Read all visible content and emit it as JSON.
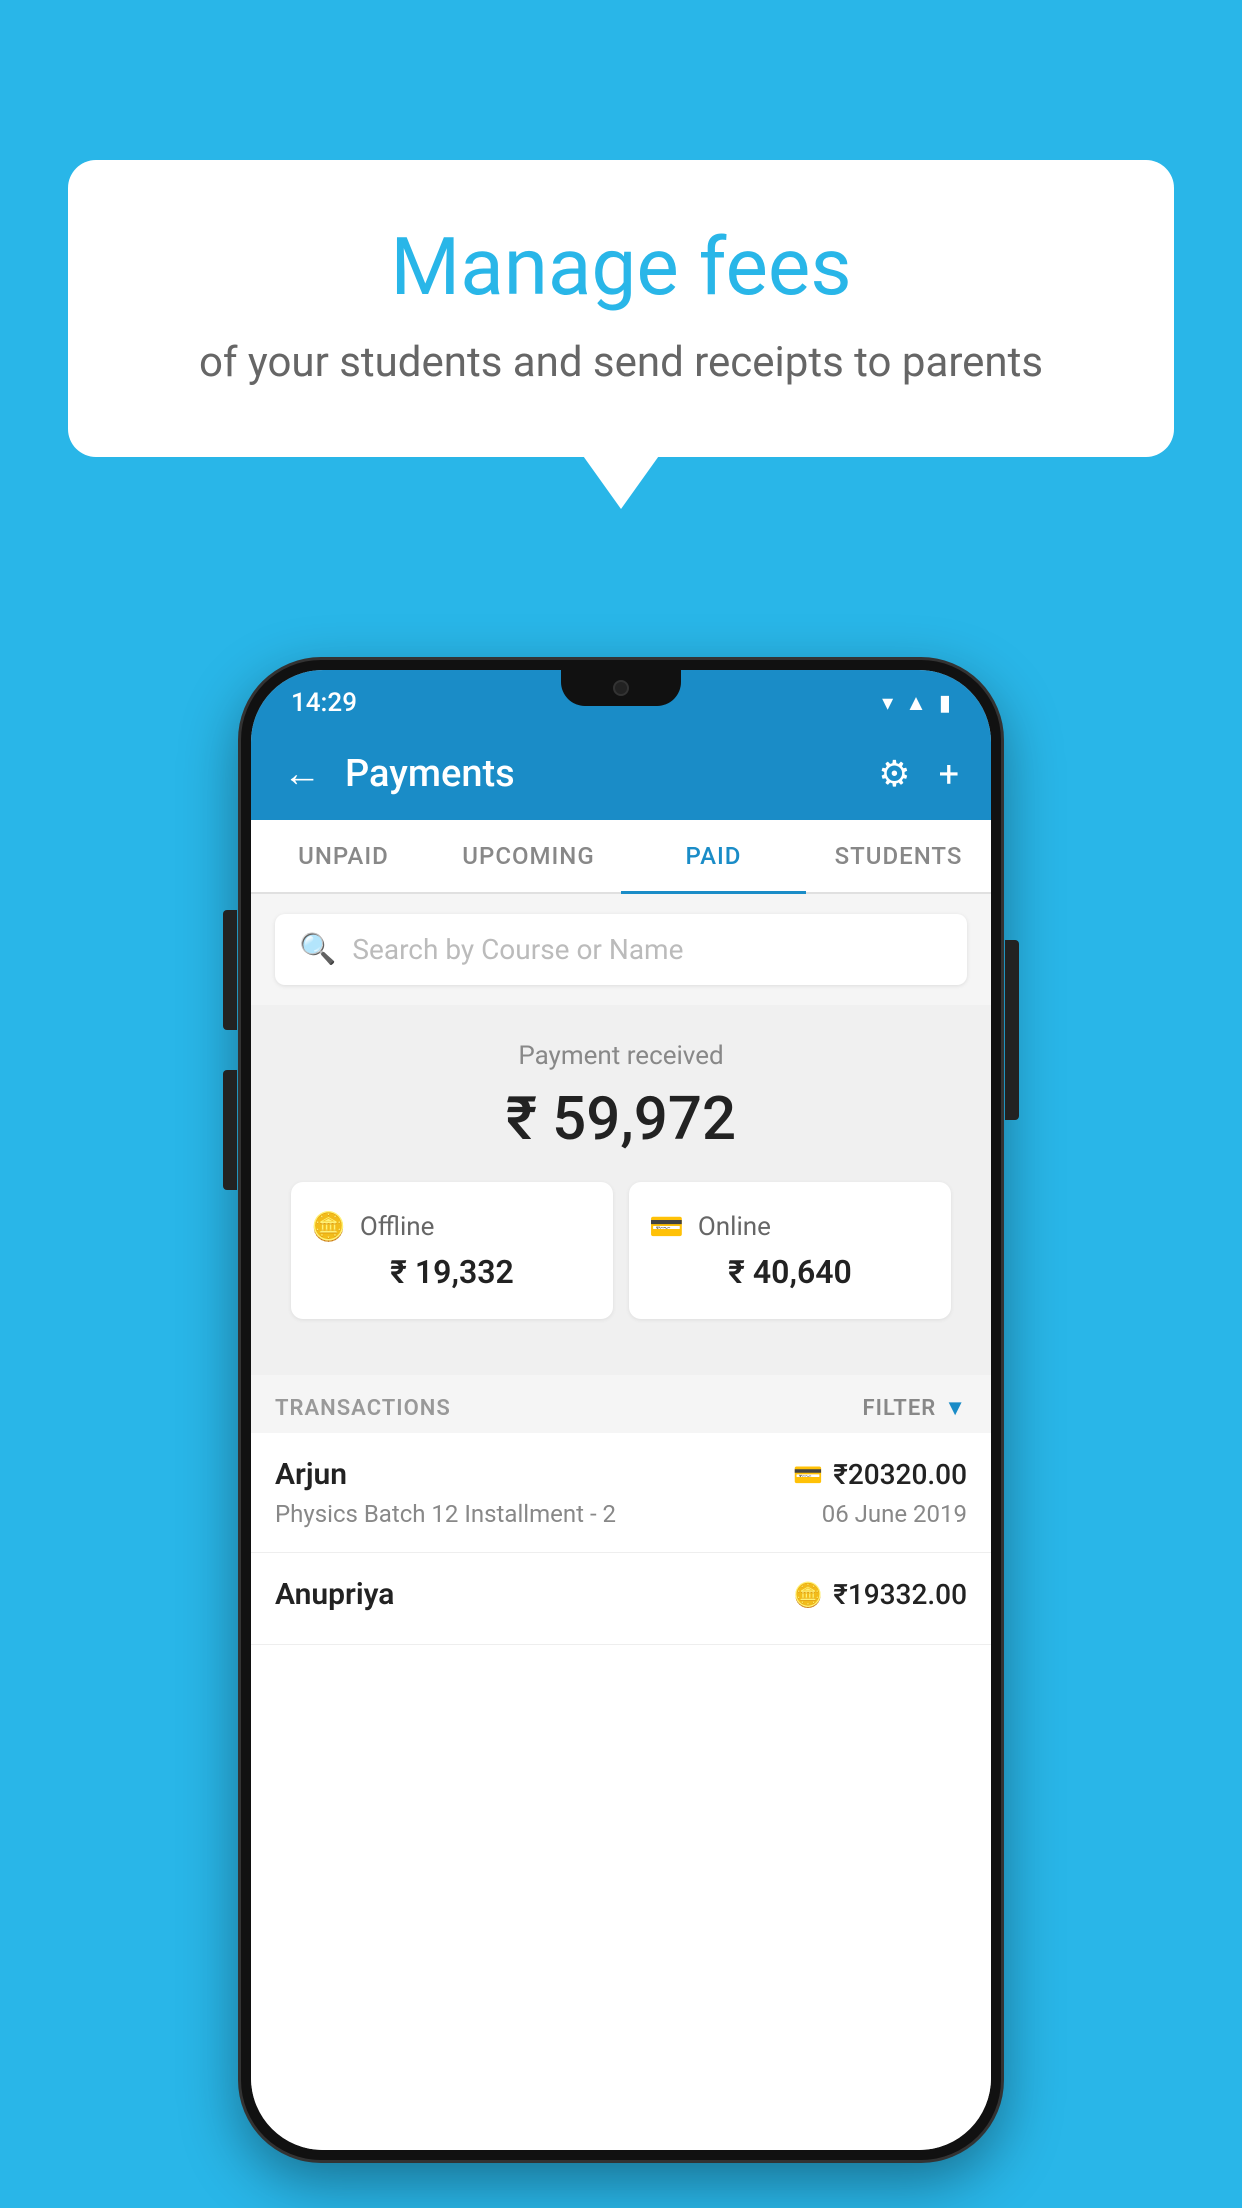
{
  "background_color": "#29b6e8",
  "bubble": {
    "title": "Manage fees",
    "subtitle": "of your students and send receipts to parents"
  },
  "status_bar": {
    "time": "14:29",
    "icons": [
      "wifi",
      "signal",
      "battery"
    ]
  },
  "app_bar": {
    "title": "Payments",
    "back_label": "←",
    "settings_label": "⚙",
    "add_label": "+"
  },
  "tabs": [
    {
      "label": "UNPAID",
      "active": false
    },
    {
      "label": "UPCOMING",
      "active": false
    },
    {
      "label": "PAID",
      "active": true
    },
    {
      "label": "STUDENTS",
      "active": false
    }
  ],
  "search": {
    "placeholder": "Search by Course or Name"
  },
  "summary": {
    "label": "Payment received",
    "amount": "₹ 59,972"
  },
  "cards": [
    {
      "icon": "💳",
      "label": "Offline",
      "amount": "₹ 19,332"
    },
    {
      "icon": "🏦",
      "label": "Online",
      "amount": "₹ 40,640"
    }
  ],
  "transactions_label": "TRANSACTIONS",
  "filter_label": "FILTER",
  "transactions": [
    {
      "name": "Arjun",
      "course": "Physics Batch 12 Installment - 2",
      "amount": "₹20320.00",
      "date": "06 June 2019",
      "method_icon": "💳"
    },
    {
      "name": "Anupriya",
      "course": "",
      "amount": "₹19332.00",
      "date": "",
      "method_icon": "💴"
    }
  ]
}
